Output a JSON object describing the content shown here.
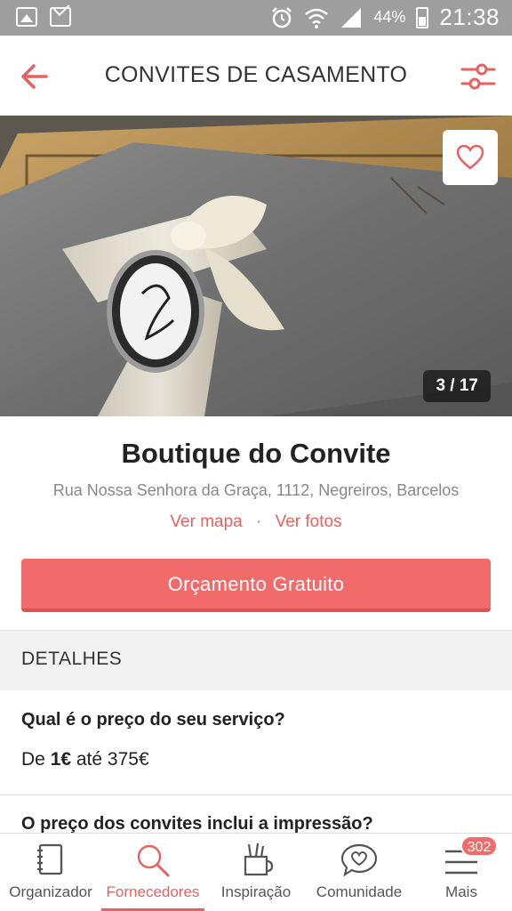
{
  "status_bar": {
    "battery": "44%",
    "time": "21:38",
    "icons": [
      "gallery-icon",
      "mail-icon",
      "alarm-icon",
      "wifi-icon",
      "signal-icon",
      "battery-icon"
    ]
  },
  "header": {
    "title": "CONVITES DE CASAMENTO",
    "back_icon": "arrow-left-icon",
    "filter_icon": "sliders-icon"
  },
  "hero": {
    "counter": "3 / 17",
    "favorite_icon": "heart-icon"
  },
  "vendor": {
    "name": "Boutique do Convite",
    "address": "Rua Nossa Senhora da Graça, 1112, Negreiros, Barcelos",
    "map_link": "Ver mapa",
    "separator": "·",
    "photos_link": "Ver fotos",
    "quote_button": "Orçamento Gratuito"
  },
  "details": {
    "title": "DETALHES",
    "faq": [
      {
        "question": "Qual é o preço do seu serviço?",
        "answer_prefix": "De ",
        "answer_min": "1€",
        "answer_suffix": " até 375€"
      },
      {
        "question": "O preço dos convites inclui a impressão?"
      }
    ]
  },
  "bottom_nav": {
    "items": [
      {
        "label": "Organizador",
        "icon": "notebook-icon"
      },
      {
        "label": "Fornecedores",
        "icon": "search-icon"
      },
      {
        "label": "Inspiração",
        "icon": "pencil-cup-icon"
      },
      {
        "label": "Comunidade",
        "icon": "heart-chat-icon"
      },
      {
        "label": "Mais",
        "icon": "menu-icon"
      }
    ],
    "badge": "302"
  },
  "colors": {
    "accent": "#e8605f",
    "button": "#f06b6a",
    "status_bar": "#9e9e9e"
  }
}
